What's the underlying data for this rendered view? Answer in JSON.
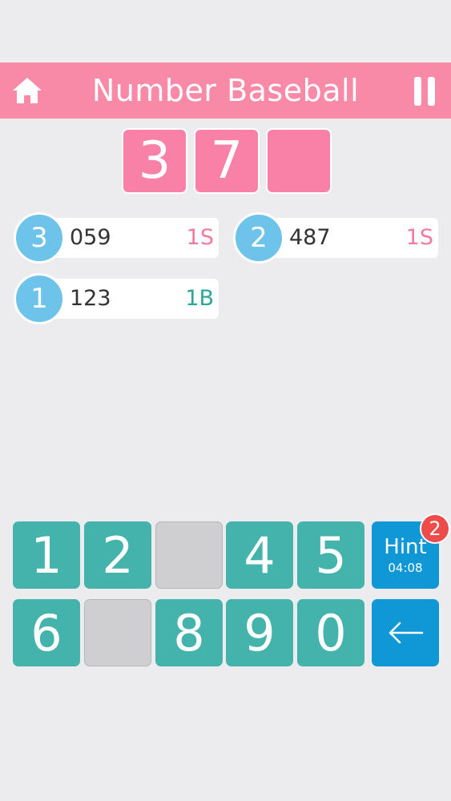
{
  "header": {
    "title": "Number Baseball",
    "home_icon": "home-icon",
    "pause_icon": "pause-icon",
    "color": "#f88aa8"
  },
  "answer": [
    "3",
    "7",
    ""
  ],
  "guesses": [
    {
      "index": "3",
      "number": "059",
      "result": "1S",
      "kind": "strike"
    },
    {
      "index": "2",
      "number": "487",
      "result": "1S",
      "kind": "strike"
    },
    {
      "index": "1",
      "number": "123",
      "result": "1B",
      "kind": "ball"
    }
  ],
  "keypad": {
    "row1": [
      "1",
      "2",
      "",
      "4",
      "5"
    ],
    "row2": [
      "6",
      "",
      "8",
      "9",
      "0"
    ],
    "hint": {
      "label": "Hint",
      "timer": "04:08",
      "badge": "2"
    },
    "back_icon": "arrow-left-icon"
  },
  "colors": {
    "key": "#44b3ab",
    "key_disabled": "#cfcfd1",
    "hint": "#0f97d6",
    "strike": "#f27a9c",
    "ball": "#2aa69a",
    "circle": "#6ec3ea"
  }
}
